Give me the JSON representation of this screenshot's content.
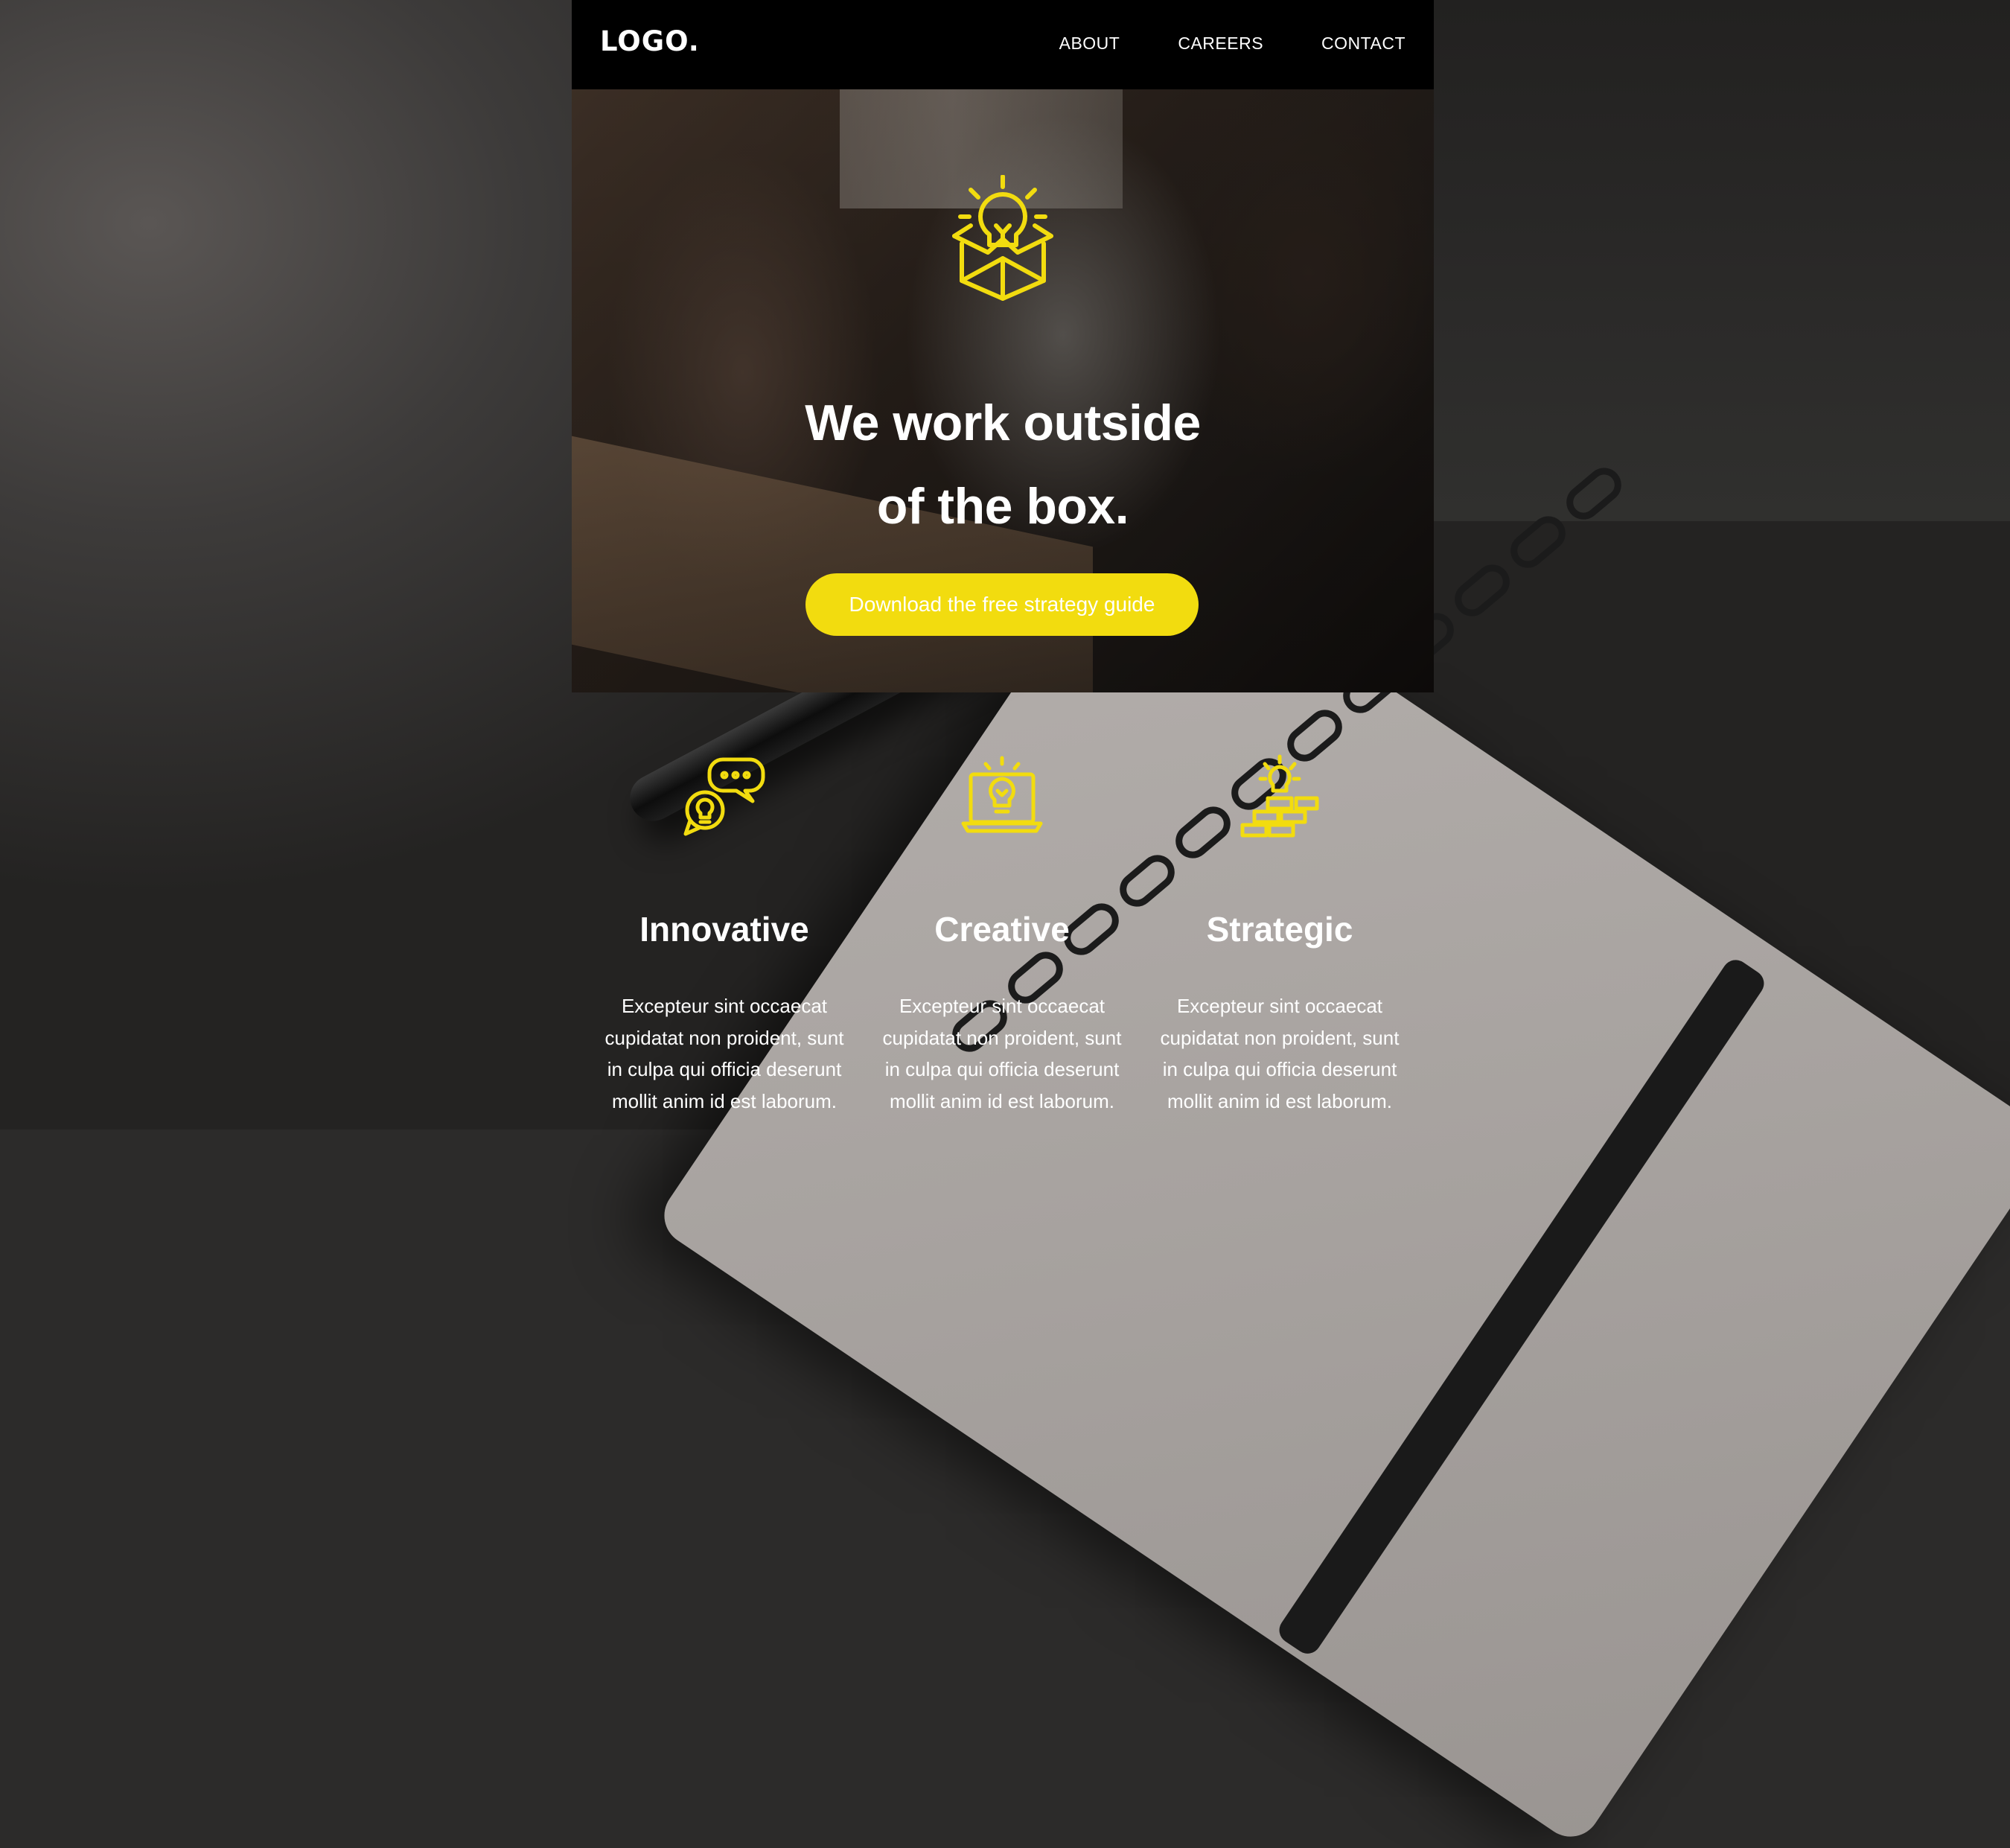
{
  "header": {
    "logo": "LOGO.",
    "nav": [
      "ABOUT",
      "CAREERS",
      "CONTACT"
    ]
  },
  "hero": {
    "icon": "lightbulb-box-icon",
    "title_line1": "We work outside",
    "title_line2": "of the box.",
    "cta_label": "Download the free strategy guide"
  },
  "features": [
    {
      "icon": "chat-bubbles-lightbulb-icon",
      "title": "Innovative",
      "text_lines": [
        "Excepteur sint occaecat",
        "cupidatat non proident, sunt",
        "in culpa qui officia deserunt",
        "mollit anim id est laborum."
      ]
    },
    {
      "icon": "laptop-lightbulb-icon",
      "title": "Creative",
      "text_lines": [
        "Excepteur sint occaecat",
        "cupidatat non proident, sunt",
        "in culpa qui officia deserunt",
        "mollit anim id est laborum."
      ]
    },
    {
      "icon": "bricks-lightbulb-icon",
      "title": "Strategic",
      "text_lines": [
        "Excepteur sint occaecat",
        "cupidatat non proident, sunt",
        "in culpa qui officia deserunt",
        "mollit anim id est laborum."
      ]
    }
  ],
  "colors": {
    "accent": "#f2dc0f",
    "header_bg": "#000000",
    "text": "#ffffff"
  }
}
